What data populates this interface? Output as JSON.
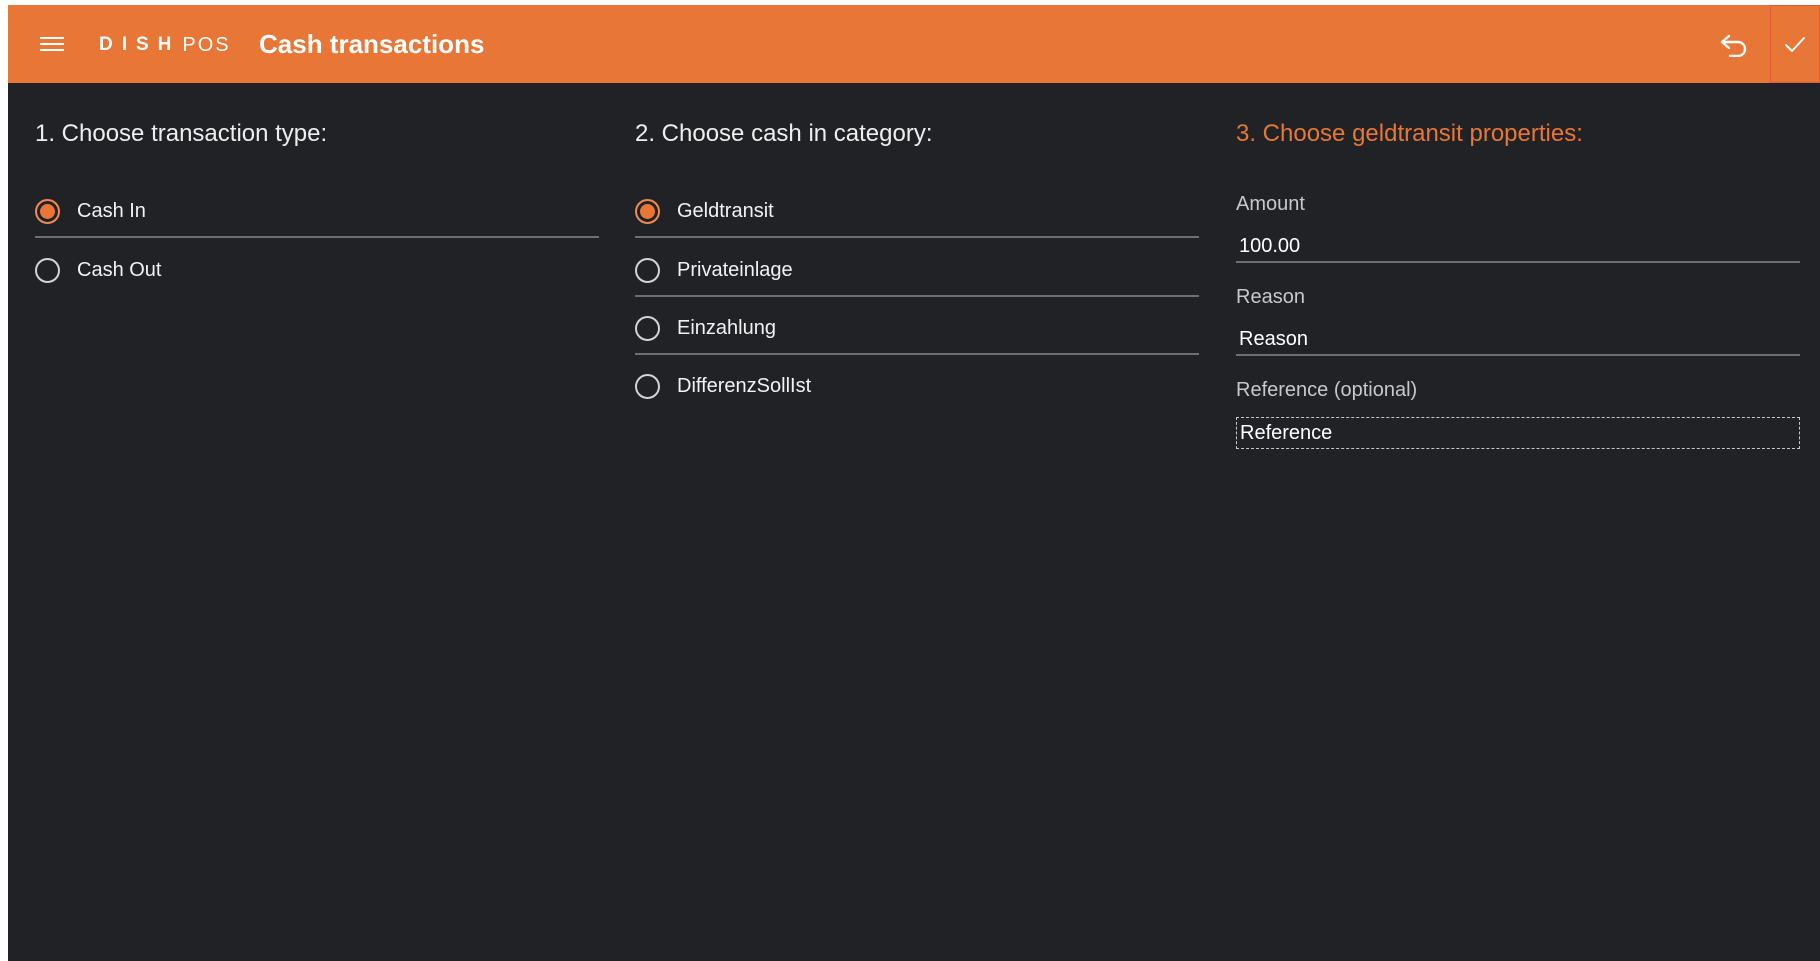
{
  "header": {
    "brand_primary": "DISH",
    "brand_secondary": "POS",
    "title": "Cash transactions",
    "background_color": "#e87636",
    "icons": [
      "hamburger-menu-icon",
      "undo-icon",
      "checkmark-icon"
    ]
  },
  "step1": {
    "title": "1. Choose transaction type:",
    "options": [
      {
        "label": "Cash In",
        "selected": true
      },
      {
        "label": "Cash Out",
        "selected": false
      }
    ]
  },
  "step2": {
    "title": "2. Choose cash in category:",
    "options": [
      {
        "label": "Geldtransit",
        "selected": true
      },
      {
        "label": "Privateinlage",
        "selected": false
      },
      {
        "label": "Einzahlung",
        "selected": false
      },
      {
        "label": "DifferenzSollIst",
        "selected": false
      }
    ]
  },
  "step3": {
    "title": "3. Choose geldtransit properties:",
    "title_color": "#e87636",
    "fields": {
      "amount": {
        "label": "Amount",
        "value": "100.00"
      },
      "reason": {
        "label": "Reason",
        "placeholder": "Reason"
      },
      "reference": {
        "label": "Reference (optional)",
        "placeholder": "Reference"
      }
    }
  },
  "theme": {
    "background": "#212226",
    "accent": "#e87636",
    "divider": "#6e6f74"
  }
}
